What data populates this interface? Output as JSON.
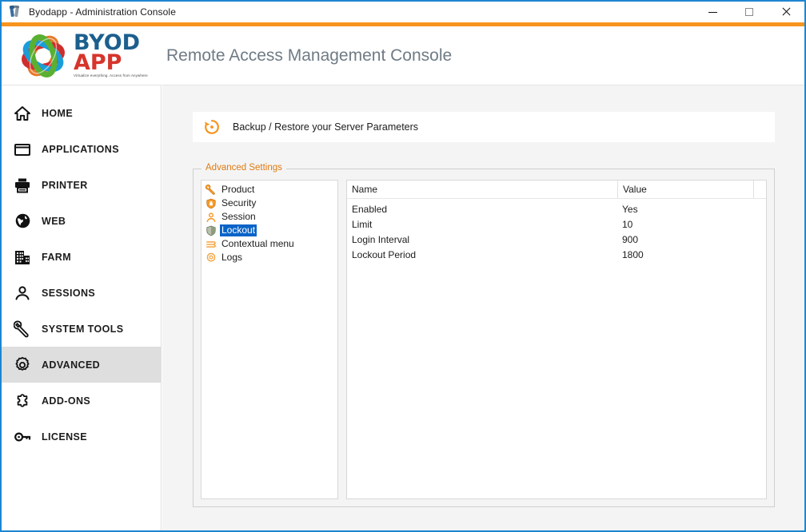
{
  "window": {
    "title": "Byodapp - Administration Console",
    "app_icon": "tools-icon",
    "controls": {
      "minimize": "minimize-icon",
      "maximize": "maximize-icon",
      "close": "close-icon"
    }
  },
  "brand": {
    "logo_mark": "byodapp-swirl-logo",
    "logo_line1": "BYOD",
    "logo_line2": "APP",
    "tagline": "Virtualize everything. Access from Anywhere",
    "console_title": "Remote Access Management Console"
  },
  "colors": {
    "accent_orange": "#f7941e",
    "window_border_blue": "#1e86d0",
    "selection_blue": "#0a64c8",
    "legend_orange": "#e07b14",
    "title_gray": "#6f7b85",
    "sidebar_active_bg": "#dedede",
    "content_bg": "#f4f4f4"
  },
  "sidebar": {
    "items": [
      {
        "label": "HOME",
        "icon": "home-icon",
        "active": false
      },
      {
        "label": "APPLICATIONS",
        "icon": "window-icon",
        "active": false
      },
      {
        "label": "PRINTER",
        "icon": "printer-icon",
        "active": false
      },
      {
        "label": "WEB",
        "icon": "globe-icon",
        "active": false
      },
      {
        "label": "FARM",
        "icon": "building-icon",
        "active": false
      },
      {
        "label": "SESSIONS",
        "icon": "user-icon",
        "active": false
      },
      {
        "label": "SYSTEM TOOLS",
        "icon": "wrench-icon",
        "active": false
      },
      {
        "label": "ADVANCED",
        "icon": "gear-icon",
        "active": true
      },
      {
        "label": "ADD-ONS",
        "icon": "puzzle-icon",
        "active": false
      },
      {
        "label": "LICENSE",
        "icon": "key-icon",
        "active": false
      }
    ]
  },
  "banner": {
    "icon": "restore-circular-arrow-icon",
    "text": "Backup / Restore your Server Parameters"
  },
  "advanced_settings": {
    "legend": "Advanced Settings",
    "tree": [
      {
        "label": "Product",
        "icon": "wrench-orange-icon",
        "selected": false
      },
      {
        "label": "Security",
        "icon": "shield-orange-icon",
        "selected": false
      },
      {
        "label": "Session",
        "icon": "user-orange-icon",
        "selected": false
      },
      {
        "label": "Lockout",
        "icon": "shield-gray-icon",
        "selected": true
      },
      {
        "label": "Contextual menu",
        "icon": "list-orange-icon",
        "selected": false
      },
      {
        "label": "Logs",
        "icon": "gear-orange-icon",
        "selected": false
      }
    ],
    "grid": {
      "columns": [
        "Name",
        "Value",
        ""
      ],
      "rows": [
        {
          "name": "Enabled",
          "value": "Yes"
        },
        {
          "name": "Limit",
          "value": "10"
        },
        {
          "name": "Login Interval",
          "value": "900"
        },
        {
          "name": "Lockout Period",
          "value": "1800"
        }
      ]
    }
  }
}
